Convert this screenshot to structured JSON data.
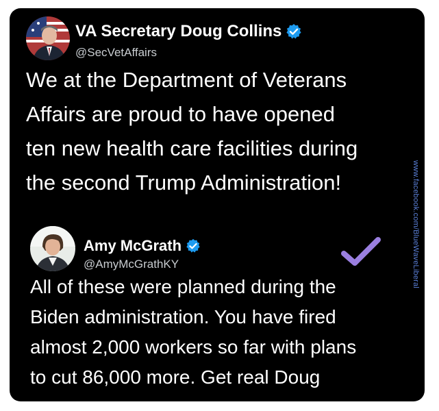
{
  "watermark": "www.facebook.com/BlueWaveLiberal",
  "tweet1": {
    "display_name": "VA Secretary Doug Collins",
    "handle": "@SecVetAffairs",
    "verified": true,
    "text_lines": [
      "We at the Department of Veterans",
      "Affairs are proud to have opened",
      "ten new health care facilities during",
      "the second Trump Administration!"
    ]
  },
  "tweet2": {
    "display_name": "Amy McGrath",
    "handle": "@AmyMcGrathKY",
    "verified": true,
    "text_lines": [
      "All of these were planned during the",
      "Biden administration. You have fired",
      "almost 2,000 workers so far with plans",
      "to cut 86,000 more. Get real Doug"
    ]
  },
  "icons": {
    "verified_badge": "verified-badge-icon",
    "overlay_check": "purple-checkmark-icon"
  },
  "colors": {
    "card_background": "#000000",
    "text": "#ffffff",
    "handle_text": "#c9cdd1",
    "verified_blue": "#1d9bf0",
    "checkmark_purple": "#9a7fe0",
    "watermark_blue": "#5a7fd6"
  }
}
